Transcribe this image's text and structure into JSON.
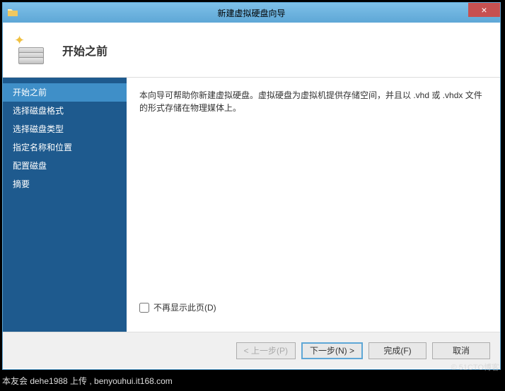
{
  "window": {
    "title": "新建虚拟硬盘向导",
    "close_label": "×"
  },
  "header": {
    "title": "开始之前"
  },
  "sidebar": {
    "items": [
      {
        "label": "开始之前",
        "active": true
      },
      {
        "label": "选择磁盘格式",
        "active": false
      },
      {
        "label": "选择磁盘类型",
        "active": false
      },
      {
        "label": "指定名称和位置",
        "active": false
      },
      {
        "label": "配置磁盘",
        "active": false
      },
      {
        "label": "摘要",
        "active": false
      }
    ]
  },
  "content": {
    "description": "本向导可帮助你新建虚拟硬盘。虚拟硬盘为虚拟机提供存储空间，并且以 .vhd 或 .vhdx 文件的形式存储在物理媒体上。",
    "checkbox_label": "不再显示此页(D)"
  },
  "footer": {
    "back": "< 上一步(P)",
    "next": "下一步(N) >",
    "finish": "完成(F)",
    "cancel": "取消"
  },
  "caption": "本友会 dehe1988 上传 , benyouhui.it168.com",
  "watermark": "© 51CTO博客"
}
